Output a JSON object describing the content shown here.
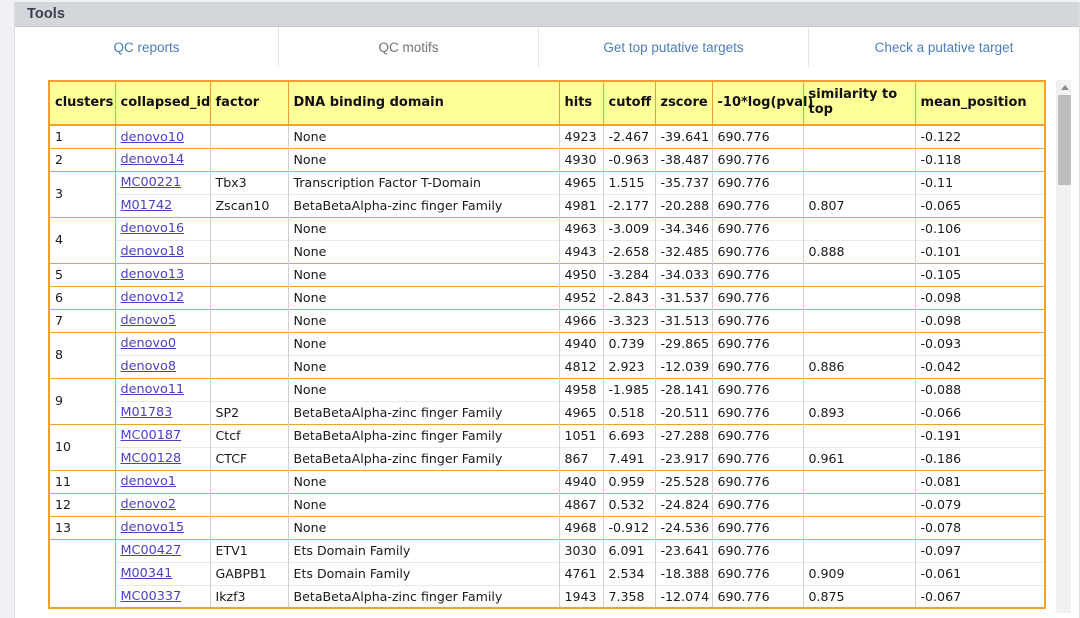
{
  "panel": {
    "title": "Tools"
  },
  "tabs": [
    {
      "label": "QC reports",
      "active": false
    },
    {
      "label": "QC motifs",
      "active": true
    },
    {
      "label": "Get top putative targets",
      "active": false
    },
    {
      "label": "Check a putative target",
      "active": false
    }
  ],
  "colors": {
    "table_border": "#f0a030",
    "header_bg": "#ffff99",
    "link": "#4b3fc4",
    "tab_link": "#4a7ebb",
    "panel_heading_bg": "#d3d6db"
  },
  "table": {
    "columns": [
      "clusters",
      "collapsed_id",
      "factor",
      "DNA binding domain",
      "hits",
      "cutoff",
      "zscore",
      "-10*log(pval)",
      "similarity to top",
      "mean_position"
    ],
    "groups": [
      {
        "cluster": "1",
        "rows": [
          {
            "collapsed_id": "denovo10",
            "factor": "",
            "domain": "None",
            "hits": "4923",
            "cutoff": "-2.467",
            "zscore": "-39.641",
            "pval": "690.776",
            "similarity": "",
            "mean_position": "-0.122"
          }
        ]
      },
      {
        "cluster": "2",
        "rows": [
          {
            "collapsed_id": "denovo14",
            "factor": "",
            "domain": "None",
            "hits": "4930",
            "cutoff": "-0.963",
            "zscore": "-38.487",
            "pval": "690.776",
            "similarity": "",
            "mean_position": "-0.118"
          }
        ]
      },
      {
        "cluster": "3",
        "rows": [
          {
            "collapsed_id": "MC00221",
            "factor": "Tbx3",
            "domain": "Transcription Factor T-Domain",
            "hits": "4965",
            "cutoff": "1.515",
            "zscore": "-35.737",
            "pval": "690.776",
            "similarity": "",
            "mean_position": "-0.11"
          },
          {
            "collapsed_id": "M01742",
            "factor": "Zscan10",
            "domain": "BetaBetaAlpha-zinc finger Family",
            "hits": "4981",
            "cutoff": "-2.177",
            "zscore": "-20.288",
            "pval": "690.776",
            "similarity": "0.807",
            "mean_position": "-0.065"
          }
        ]
      },
      {
        "cluster": "4",
        "rows": [
          {
            "collapsed_id": "denovo16",
            "factor": "",
            "domain": "None",
            "hits": "4963",
            "cutoff": "-3.009",
            "zscore": "-34.346",
            "pval": "690.776",
            "similarity": "",
            "mean_position": "-0.106"
          },
          {
            "collapsed_id": "denovo18",
            "factor": "",
            "domain": "None",
            "hits": "4943",
            "cutoff": "-2.658",
            "zscore": "-32.485",
            "pval": "690.776",
            "similarity": "0.888",
            "mean_position": "-0.101"
          }
        ]
      },
      {
        "cluster": "5",
        "rows": [
          {
            "collapsed_id": "denovo13",
            "factor": "",
            "domain": "None",
            "hits": "4950",
            "cutoff": "-3.284",
            "zscore": "-34.033",
            "pval": "690.776",
            "similarity": "",
            "mean_position": "-0.105"
          }
        ]
      },
      {
        "cluster": "6",
        "rows": [
          {
            "collapsed_id": "denovo12",
            "factor": "",
            "domain": "None",
            "hits": "4952",
            "cutoff": "-2.843",
            "zscore": "-31.537",
            "pval": "690.776",
            "similarity": "",
            "mean_position": "-0.098"
          }
        ]
      },
      {
        "cluster": "7",
        "rows": [
          {
            "collapsed_id": "denovo5",
            "factor": "",
            "domain": "None",
            "hits": "4966",
            "cutoff": "-3.323",
            "zscore": "-31.513",
            "pval": "690.776",
            "similarity": "",
            "mean_position": "-0.098"
          }
        ]
      },
      {
        "cluster": "8",
        "rows": [
          {
            "collapsed_id": "denovo0",
            "factor": "",
            "domain": "None",
            "hits": "4940",
            "cutoff": "0.739",
            "zscore": "-29.865",
            "pval": "690.776",
            "similarity": "",
            "mean_position": "-0.093"
          },
          {
            "collapsed_id": "denovo8",
            "factor": "",
            "domain": "None",
            "hits": "4812",
            "cutoff": "2.923",
            "zscore": "-12.039",
            "pval": "690.776",
            "similarity": "0.886",
            "mean_position": "-0.042"
          }
        ]
      },
      {
        "cluster": "9",
        "rows": [
          {
            "collapsed_id": "denovo11",
            "factor": "",
            "domain": "None",
            "hits": "4958",
            "cutoff": "-1.985",
            "zscore": "-28.141",
            "pval": "690.776",
            "similarity": "",
            "mean_position": "-0.088"
          },
          {
            "collapsed_id": "M01783",
            "factor": "SP2",
            "domain": "BetaBetaAlpha-zinc finger Family",
            "hits": "4965",
            "cutoff": "0.518",
            "zscore": "-20.511",
            "pval": "690.776",
            "similarity": "0.893",
            "mean_position": "-0.066"
          }
        ]
      },
      {
        "cluster": "10",
        "rows": [
          {
            "collapsed_id": "MC00187",
            "factor": "Ctcf",
            "domain": "BetaBetaAlpha-zinc finger Family",
            "hits": "1051",
            "cutoff": "6.693",
            "zscore": "-27.288",
            "pval": "690.776",
            "similarity": "",
            "mean_position": "-0.191"
          },
          {
            "collapsed_id": "MC00128",
            "factor": "CTCF",
            "domain": "BetaBetaAlpha-zinc finger Family",
            "hits": "867",
            "cutoff": "7.491",
            "zscore": "-23.917",
            "pval": "690.776",
            "similarity": "0.961",
            "mean_position": "-0.186"
          }
        ]
      },
      {
        "cluster": "11",
        "rows": [
          {
            "collapsed_id": "denovo1",
            "factor": "",
            "domain": "None",
            "hits": "4940",
            "cutoff": "0.959",
            "zscore": "-25.528",
            "pval": "690.776",
            "similarity": "",
            "mean_position": "-0.081"
          }
        ]
      },
      {
        "cluster": "12",
        "rows": [
          {
            "collapsed_id": "denovo2",
            "factor": "",
            "domain": "None",
            "hits": "4867",
            "cutoff": "0.532",
            "zscore": "-24.824",
            "pval": "690.776",
            "similarity": "",
            "mean_position": "-0.079"
          }
        ]
      },
      {
        "cluster": "13",
        "rows": [
          {
            "collapsed_id": "denovo15",
            "factor": "",
            "domain": "None",
            "hits": "4968",
            "cutoff": "-0.912",
            "zscore": "-24.536",
            "pval": "690.776",
            "similarity": "",
            "mean_position": "-0.078"
          }
        ]
      },
      {
        "cluster": "",
        "rows": [
          {
            "collapsed_id": "MC00427",
            "factor": "ETV1",
            "domain": "Ets Domain Family",
            "hits": "3030",
            "cutoff": "6.091",
            "zscore": "-23.641",
            "pval": "690.776",
            "similarity": "",
            "mean_position": "-0.097"
          },
          {
            "collapsed_id": "M00341",
            "factor": "GABPB1",
            "domain": "Ets Domain Family",
            "hits": "4761",
            "cutoff": "2.534",
            "zscore": "-18.388",
            "pval": "690.776",
            "similarity": "0.909",
            "mean_position": "-0.061"
          },
          {
            "collapsed_id": "MC00337",
            "factor": "Ikzf3",
            "domain": "BetaBetaAlpha-zinc finger Family",
            "hits": "1943",
            "cutoff": "7.358",
            "zscore": "-12.074",
            "pval": "690.776",
            "similarity": "0.875",
            "mean_position": "-0.067"
          }
        ]
      }
    ]
  },
  "scrollbar": {
    "up_arrow_icon": "triangle-up-icon",
    "thumb_position": "top"
  }
}
